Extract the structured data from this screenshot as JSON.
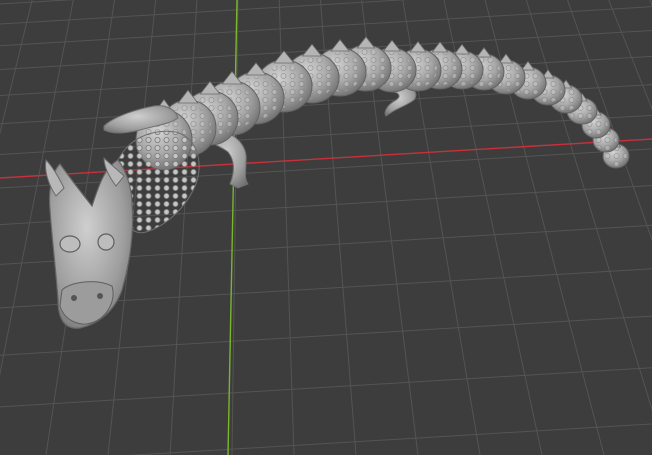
{
  "viewport": {
    "mode": "3d-viewport",
    "background_color": "#3d3d3d",
    "grid_color": "#545454",
    "x_axis_color": "#c8313b",
    "y_axis_color": "#7bb62d"
  },
  "scene": {
    "object": "articulated-dragon-mesh",
    "material_color": "#a9a9a9",
    "shading": "solid"
  }
}
